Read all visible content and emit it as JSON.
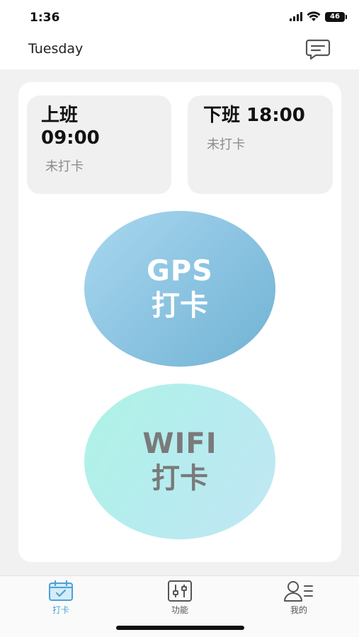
{
  "status_bar": {
    "time": "1:36",
    "battery": "46",
    "icons": [
      "signal-icon",
      "wifi-icon",
      "battery-icon"
    ]
  },
  "header": {
    "day": "Tuesday",
    "message_icon": "message-icon"
  },
  "shifts": {
    "on_duty": {
      "title_line1": "上班",
      "title_line2": "09:00",
      "status": "未打卡"
    },
    "off_duty": {
      "title": "下班 18:00",
      "status": "未打卡"
    }
  },
  "buttons": {
    "gps": {
      "line1": "GPS",
      "line2": "打卡"
    },
    "wifi": {
      "line1": "WIFI",
      "line2": "打卡"
    }
  },
  "tabs": [
    {
      "label": "打卡",
      "icon": "calendar-check-icon",
      "active": true
    },
    {
      "label": "功能",
      "icon": "sliders-icon",
      "active": false
    },
    {
      "label": "我的",
      "icon": "user-list-icon",
      "active": false
    }
  ],
  "colors": {
    "accent": "#4aa3d6",
    "gps_gradient": [
      "#a9d8ef",
      "#72b3d3"
    ],
    "wifi_gradient": [
      "#aef3e4",
      "#c1e6f3"
    ],
    "status_text": "#8c8c8c",
    "background": "#f1f1f1"
  }
}
